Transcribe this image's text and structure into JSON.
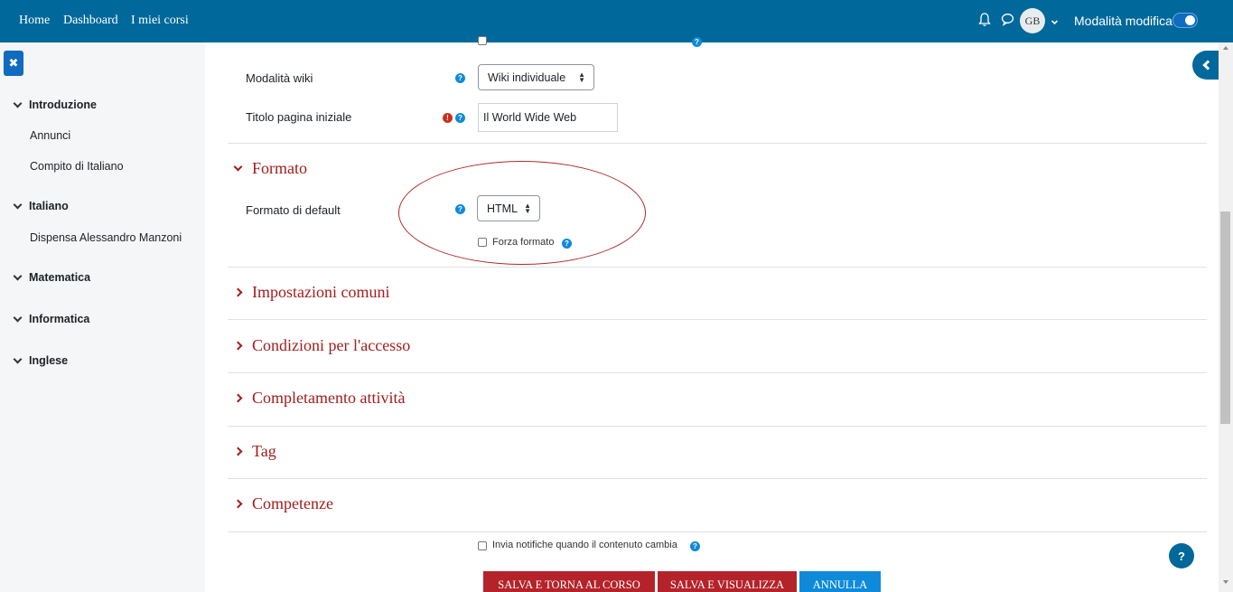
{
  "navbar": {
    "links": [
      "Home",
      "Dashboard",
      "I miei corsi"
    ],
    "avatar_initials": "GB",
    "edit_mode_label": "Modalità modifica",
    "edit_mode_on": true
  },
  "drawer": {
    "sections": [
      {
        "title": "Introduzione",
        "items": [
          "Annunci",
          "Compito di Italiano"
        ]
      },
      {
        "title": "Italiano",
        "items": [
          "Dispensa Alessandro Manzoni"
        ]
      },
      {
        "title": "Matematica",
        "items": []
      },
      {
        "title": "Informatica",
        "items": []
      },
      {
        "title": "Inglese",
        "items": []
      }
    ]
  },
  "form": {
    "wiki_mode_label": "Modalità wiki",
    "wiki_mode_value": "Wiki individuale",
    "first_page_label": "Titolo pagina iniziale",
    "first_page_value": "Il World Wide Web",
    "format_section": "Formato",
    "default_format_label": "Formato di default",
    "default_format_value": "HTML",
    "force_format_label": "Forza formato",
    "collapsed_sections": [
      "Impostazioni comuni",
      "Condizioni per l'accesso",
      "Completamento attività",
      "Tag",
      "Competenze"
    ],
    "notify_label": "Invia notifiche quando il contenuto cambia"
  },
  "buttons": {
    "save_return": "SALVA E TORNA AL CORSO",
    "save_display": "SALVA E VISUALIZZA",
    "cancel": "ANNULLA"
  },
  "colors": {
    "navbar": "#00689a",
    "section_header": "#a21d1d",
    "primary_button": "#b4232a",
    "cancel_button": "#0f8ad9"
  }
}
